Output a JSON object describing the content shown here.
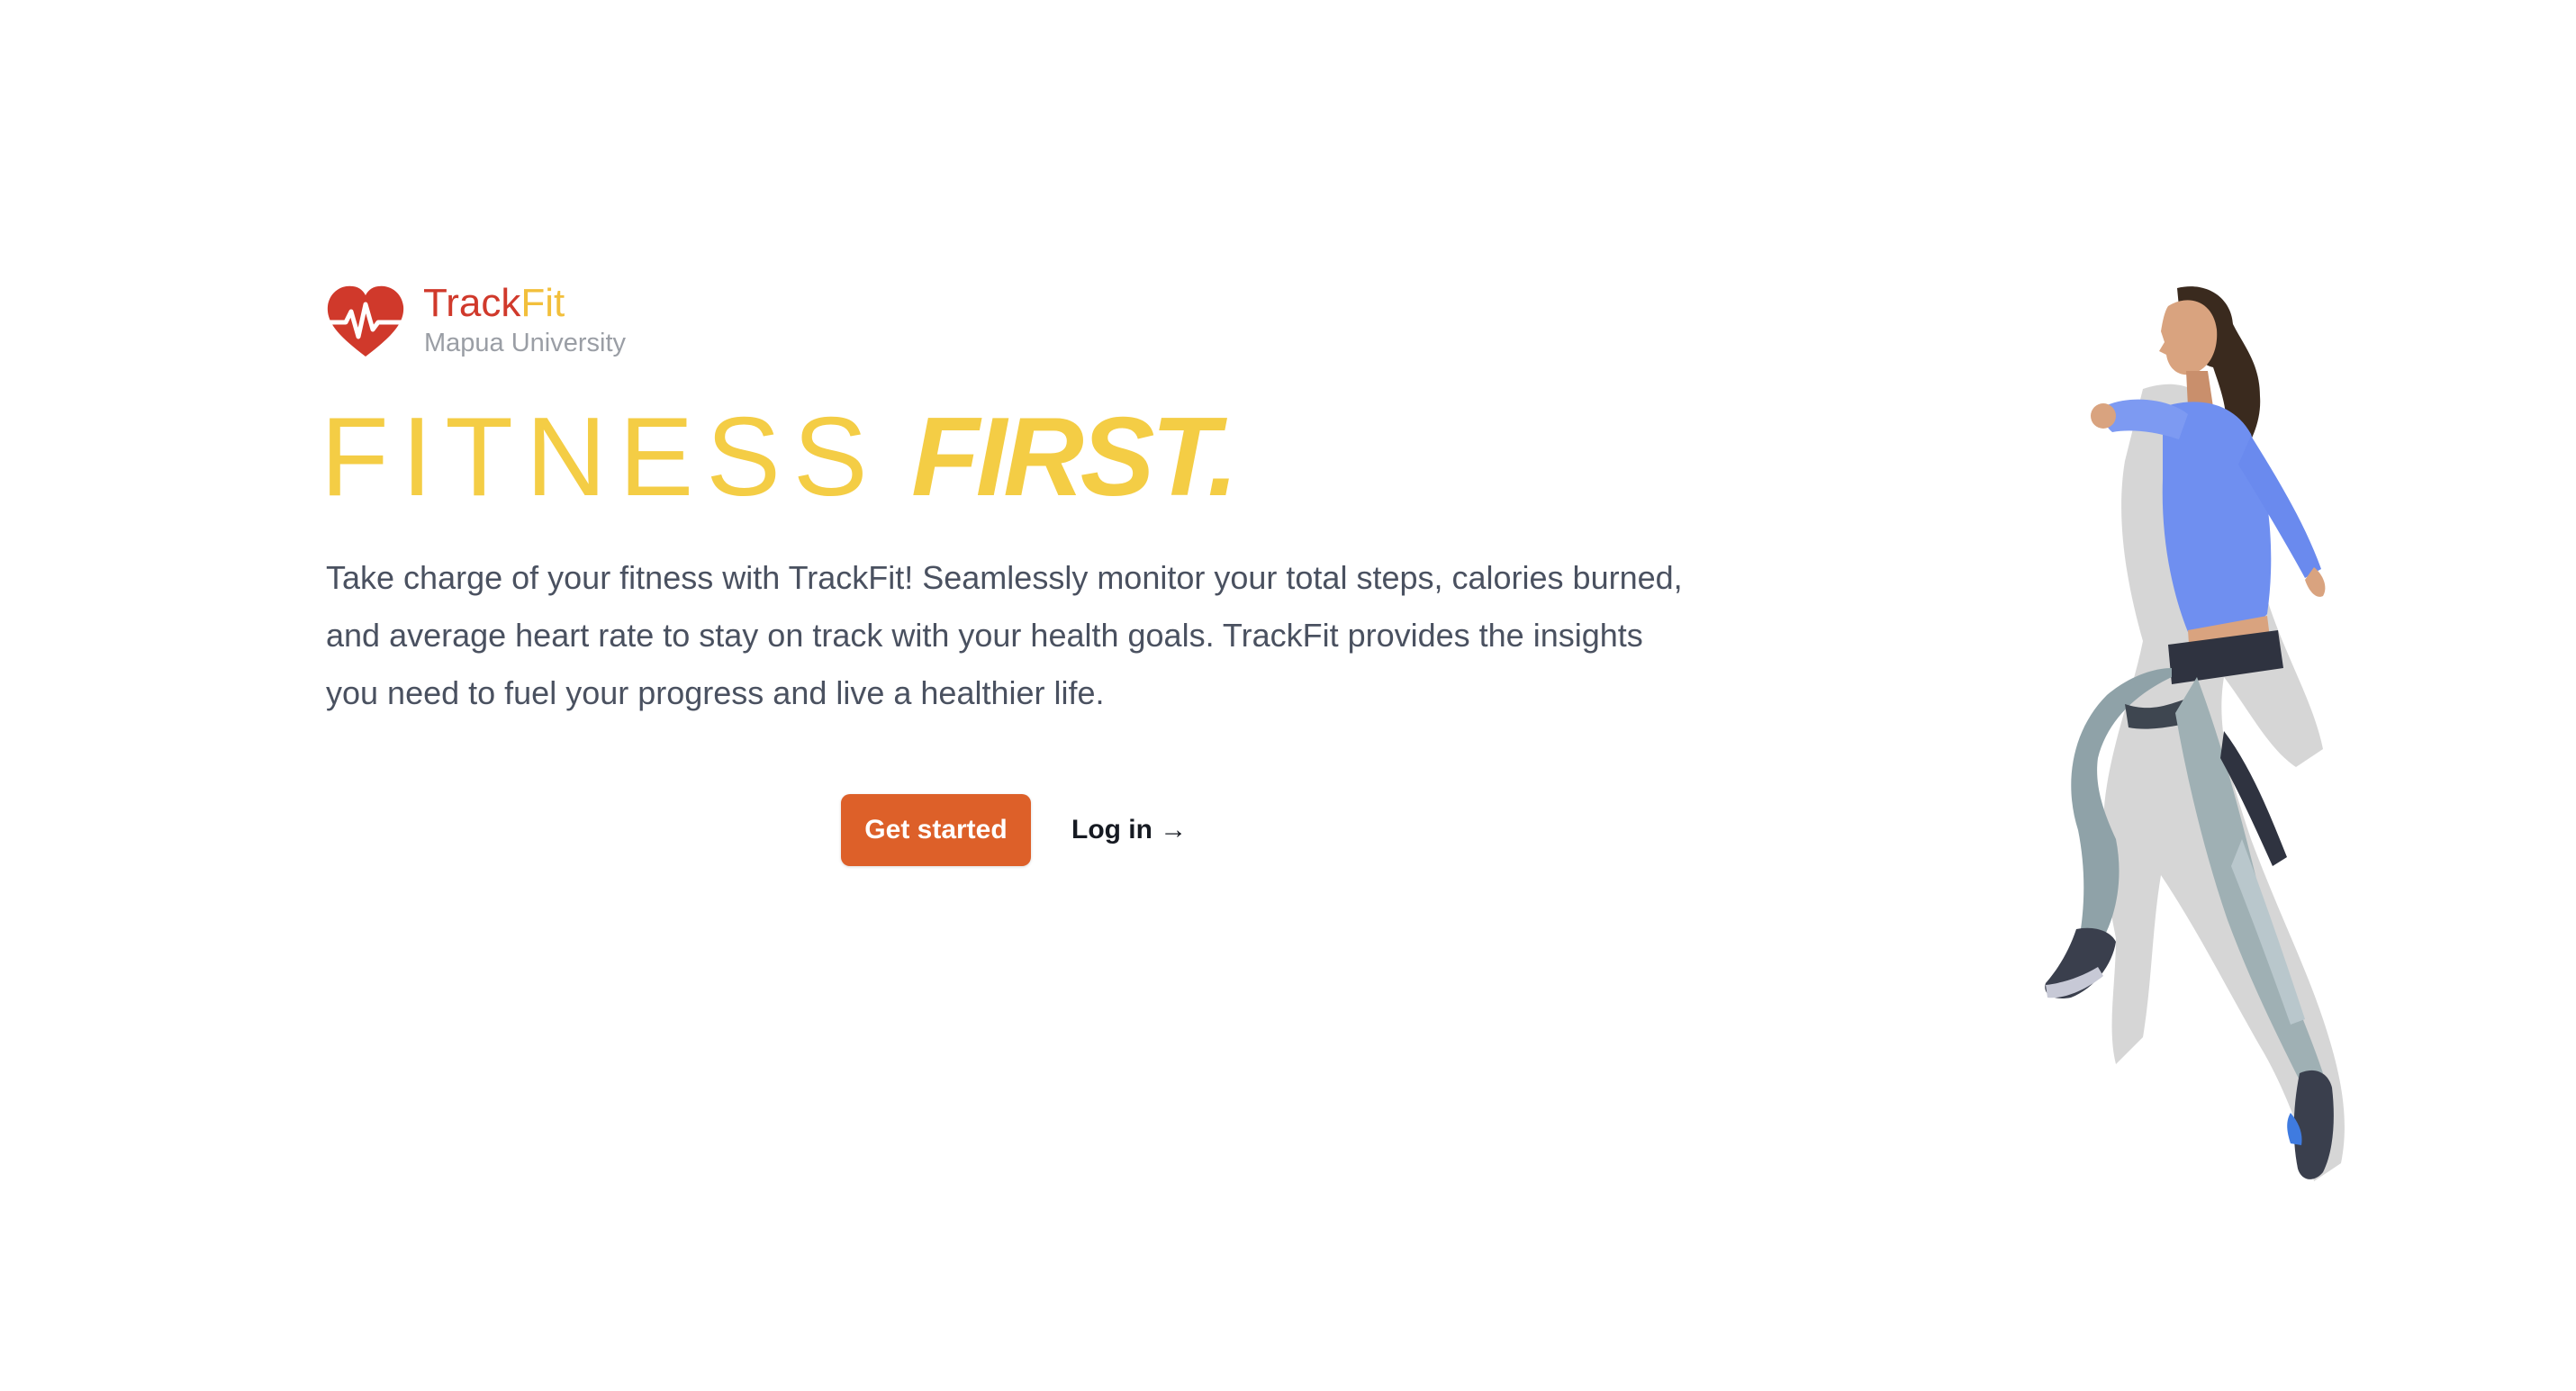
{
  "brand": {
    "name_part1": "Track",
    "name_part2": "Fit",
    "subtitle": "Mapua University"
  },
  "hero": {
    "headline_light": "FITNESS",
    "headline_bold": "FIRST.",
    "description": "Take charge of your fitness with TrackFit! Seamlessly monitor your total steps, calories burned, and average heart rate to stay on track with your health goals. TrackFit provides the insights you need to fuel your progress and live a healthier life.",
    "primary_button": "Get started",
    "secondary_link": "Log in →"
  },
  "colors": {
    "brand_red": "#d0392b",
    "brand_yellow": "#f2bf3b",
    "headline_yellow": "#f4cd45",
    "button_orange": "#dd6029",
    "body_text": "#4a5160"
  },
  "icons": {
    "logo": "heart-pulse-icon",
    "image": "jumping-athlete-image"
  }
}
